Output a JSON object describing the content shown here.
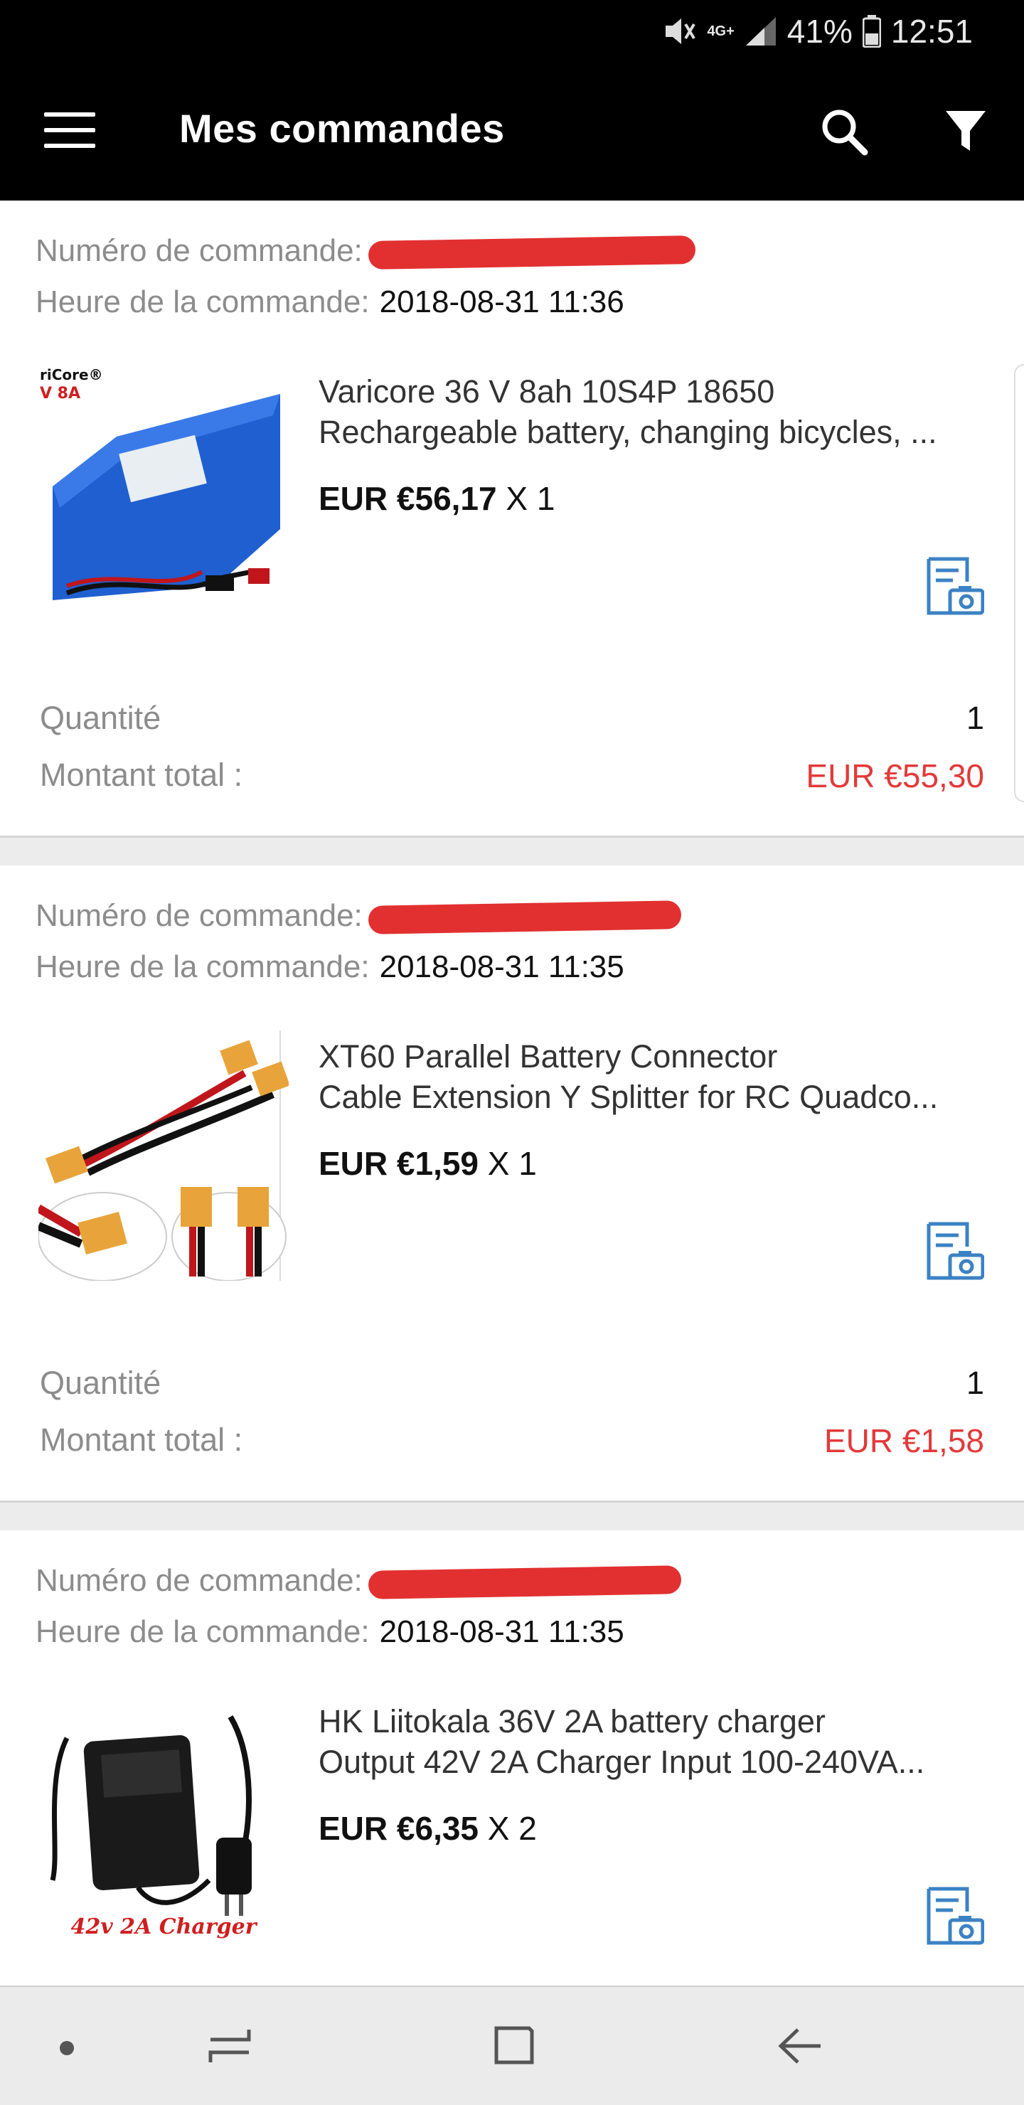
{
  "status_bar": {
    "network": "4G+",
    "battery": "41%",
    "time": "12:51"
  },
  "app_bar": {
    "title": "Mes commandes",
    "icons": [
      "menu-icon",
      "search-icon",
      "filter-icon"
    ]
  },
  "labels": {
    "order_number": "Numéro de commande:",
    "order_time": "Heure de la commande:",
    "quantity": "Quantité",
    "total": "Montant total :"
  },
  "orders": [
    {
      "time": "2018-08-31 11:36",
      "title_line1": "Varicore 36 V 8ah 10S4P 18650",
      "title_line2": "Rechargeable battery, changing bicycles, ...",
      "unit_price": "EUR €56,17",
      "multiplier": "X 1",
      "quantity": "1",
      "total": "EUR €55,30",
      "image_label_brand": "riCore®",
      "image_label_spec": "V 8A"
    },
    {
      "time": "2018-08-31 11:35",
      "title_line1": "XT60  Parallel Battery Connector",
      "title_line2": "Cable Extension Y Splitter for RC Quadco...",
      "unit_price": "EUR €1,59",
      "multiplier": "X 1",
      "quantity": "1",
      "total": "EUR €1,58"
    },
    {
      "time": "2018-08-31 11:35",
      "title_line1": "HK Liitokala 36V 2A battery charger",
      "title_line2": "Output 42V 2A Charger Input 100-240VA...",
      "unit_price": "EUR €6,35",
      "multiplier": "X 2",
      "image_label": "42v 2A Charger"
    }
  ],
  "colors": {
    "accent_red": "#e23a3a",
    "icon_blue": "#3b82c4",
    "app_bar": "#000000"
  }
}
